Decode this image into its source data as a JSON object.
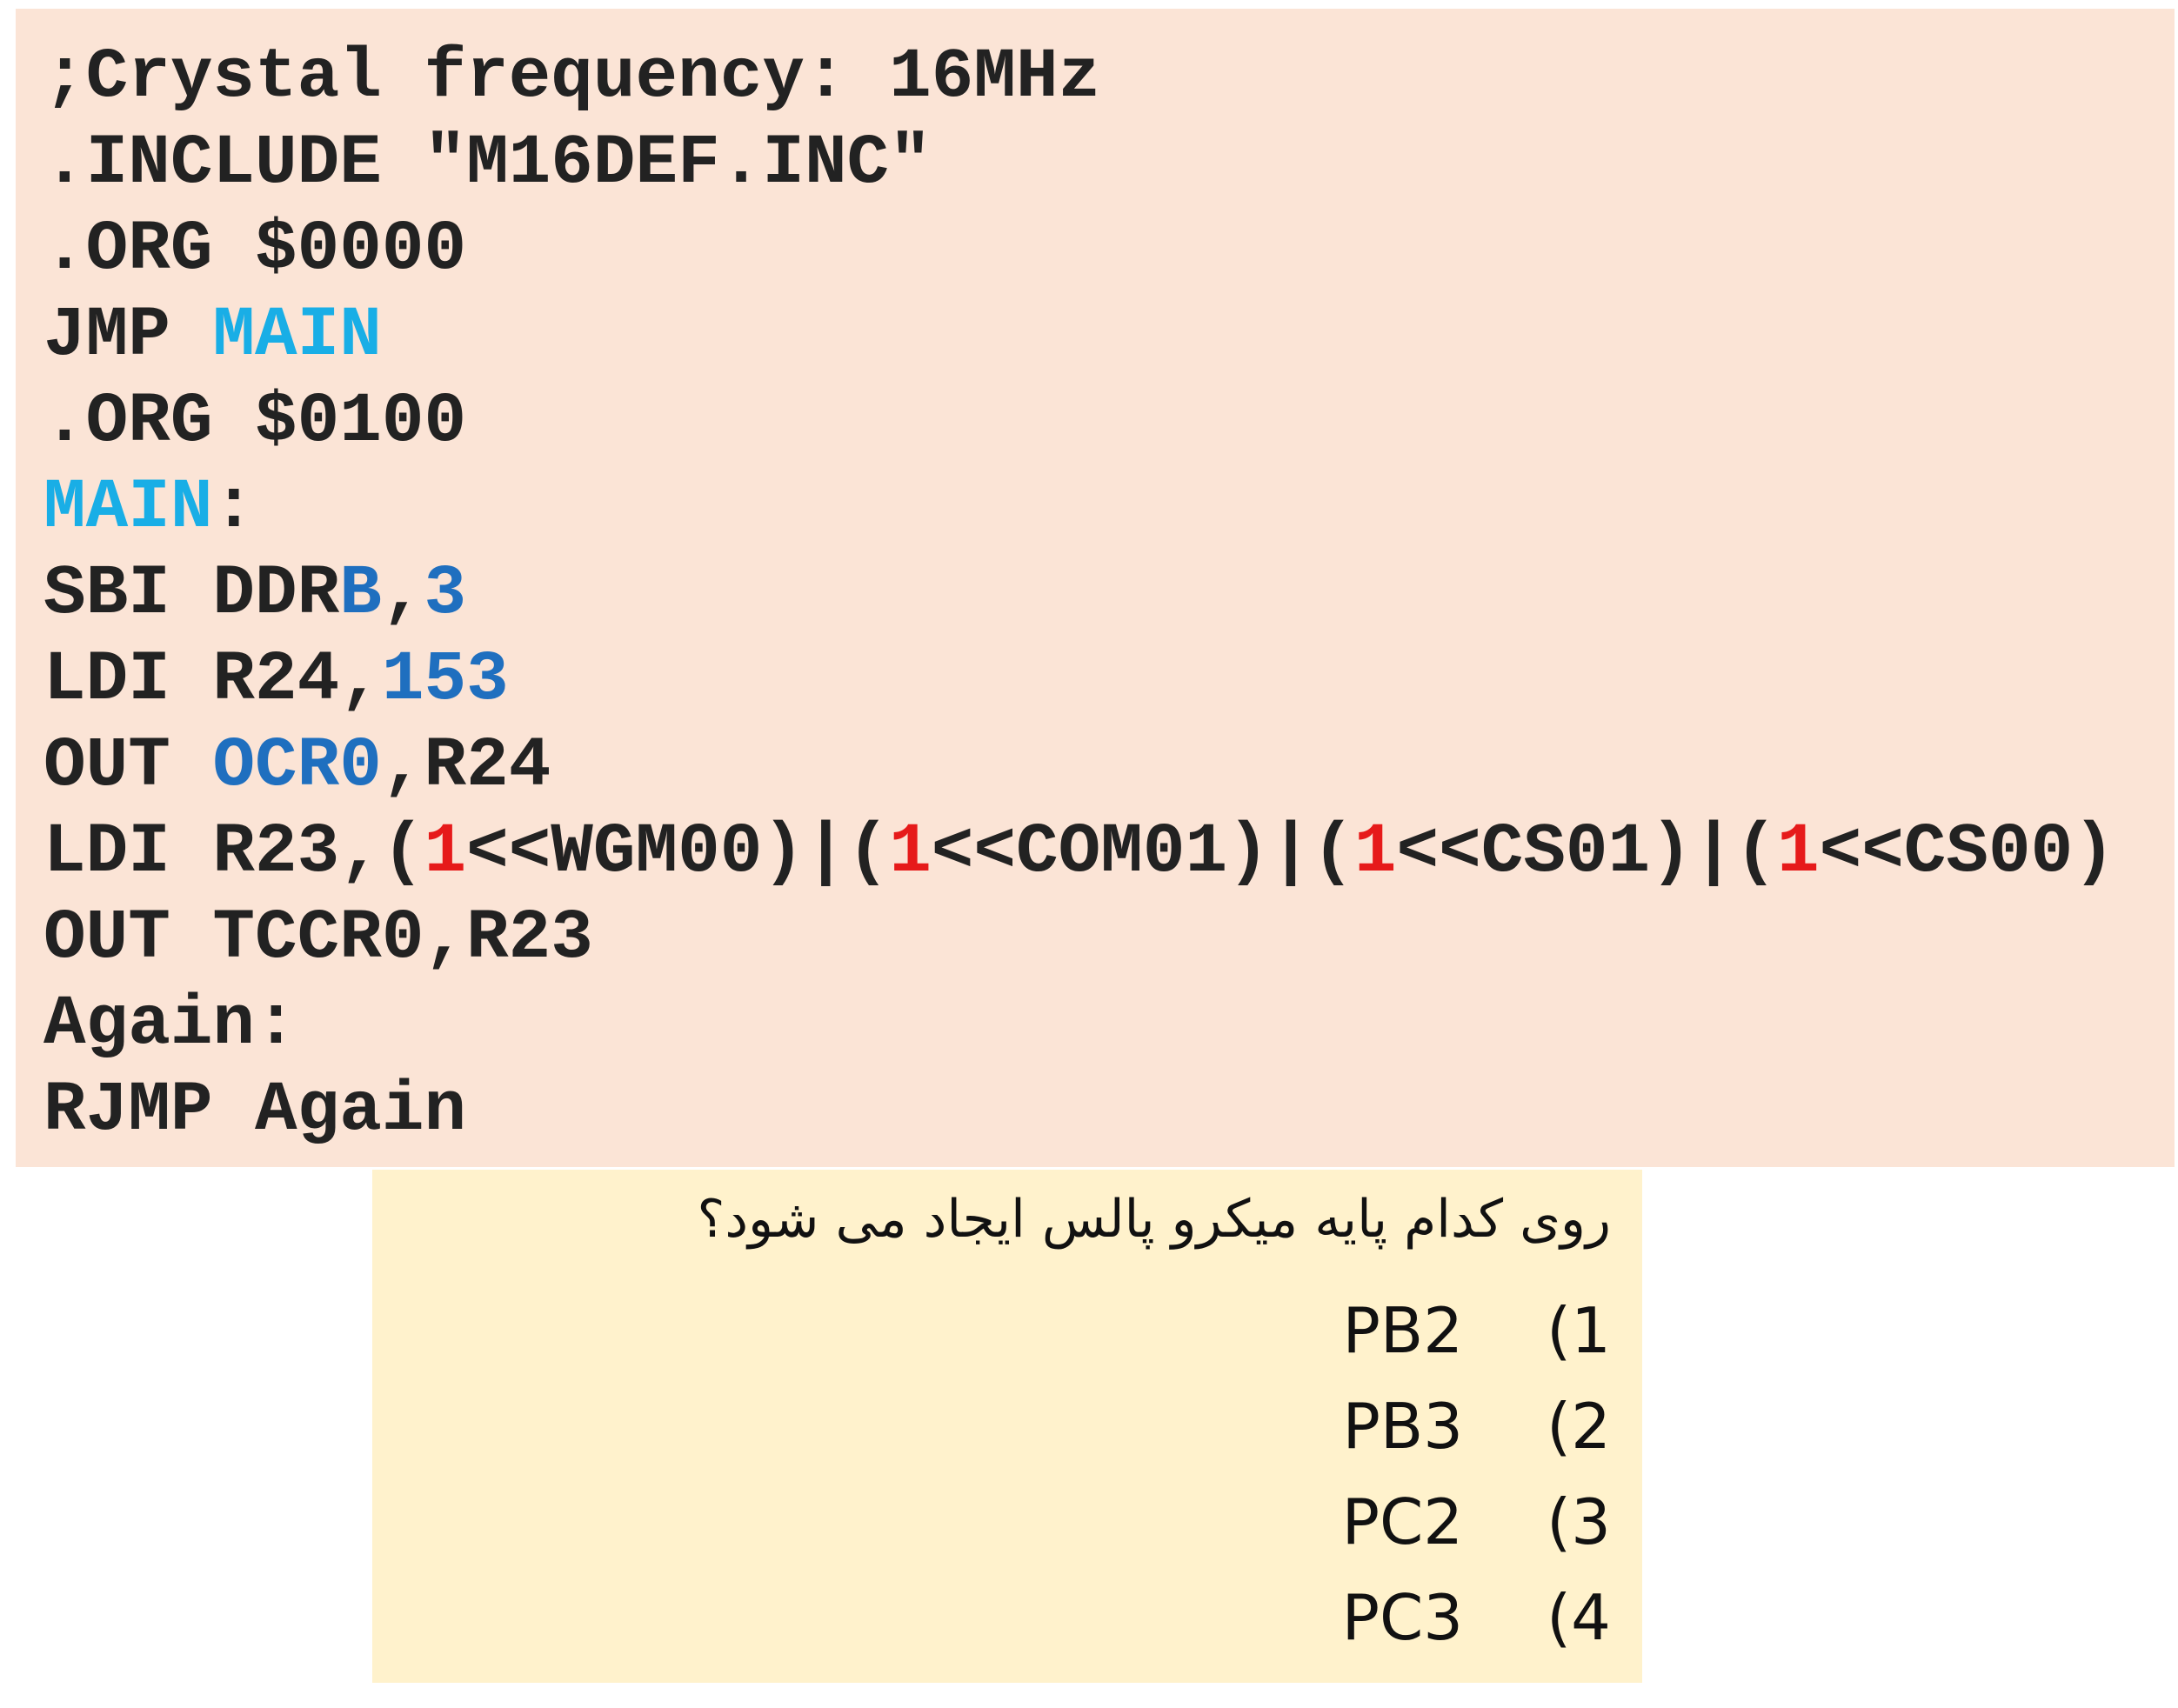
{
  "code": {
    "colors": {
      "default": "#222222",
      "label": "#19aee6",
      "operand": "#1f6fbf",
      "literal": "#e61a1a"
    },
    "lines": [
      [
        {
          "text": ";Crystal frequency: 16MHz",
          "color": "default"
        }
      ],
      [
        {
          "text": ".INCLUDE \"M16DEF.INC\"",
          "color": "default"
        }
      ],
      [
        {
          "text": ".ORG $0000",
          "color": "default"
        }
      ],
      [
        {
          "text": "JMP ",
          "color": "default"
        },
        {
          "text": "MAIN",
          "color": "label"
        }
      ],
      [
        {
          "text": ".ORG $0100",
          "color": "default"
        }
      ],
      [
        {
          "text": "MAIN",
          "color": "label"
        },
        {
          "text": ":",
          "color": "default"
        }
      ],
      [
        {
          "text": "SBI DDR",
          "color": "default"
        },
        {
          "text": "B",
          "color": "operand"
        },
        {
          "text": ",",
          "color": "default"
        },
        {
          "text": "3",
          "color": "operand"
        }
      ],
      [
        {
          "text": "LDI R24,",
          "color": "default"
        },
        {
          "text": "153",
          "color": "operand"
        }
      ],
      [
        {
          "text": "OUT ",
          "color": "default"
        },
        {
          "text": "OCR0",
          "color": "operand"
        },
        {
          "text": ",R24",
          "color": "default"
        }
      ],
      [
        {
          "text": "LDI R23,(",
          "color": "default"
        },
        {
          "text": "1",
          "color": "literal"
        },
        {
          "text": "<<WGM00)|(",
          "color": "default"
        },
        {
          "text": "1",
          "color": "literal"
        },
        {
          "text": "<<COM01)|(",
          "color": "default"
        },
        {
          "text": "1",
          "color": "literal"
        },
        {
          "text": "<<CS01)|(",
          "color": "default"
        },
        {
          "text": "1",
          "color": "literal"
        },
        {
          "text": "<<CS00)",
          "color": "default"
        }
      ],
      [
        {
          "text": "OUT TCCR0,R23",
          "color": "default"
        }
      ],
      [
        {
          "text": "Again:",
          "color": "default"
        }
      ],
      [
        {
          "text": "RJMP Again",
          "color": "default"
        }
      ]
    ]
  },
  "question": {
    "text": "روی کدام پایه میکرو پالس ایجاد می شود؟",
    "options": [
      {
        "number": "(1",
        "label": "PB2"
      },
      {
        "number": "(2",
        "label": "PB3"
      },
      {
        "number": "(3",
        "label": "PC2"
      },
      {
        "number": "(4",
        "label": "PC3"
      }
    ]
  }
}
